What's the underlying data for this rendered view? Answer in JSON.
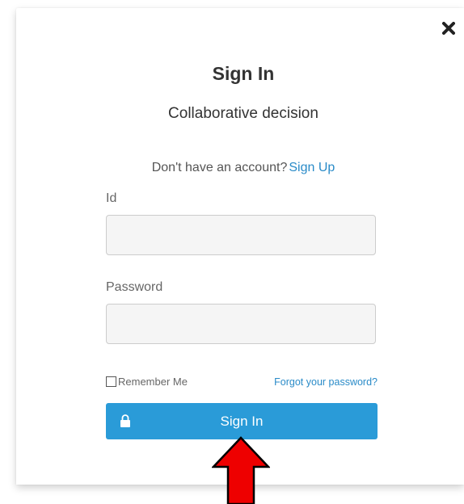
{
  "modal": {
    "title": "Sign In",
    "subtitle": "Collaborative decision",
    "account_prompt": "Don't have an account?",
    "signup_link": "Sign Up",
    "id_label": "Id",
    "id_value": "",
    "password_label": "Password",
    "password_value": "",
    "remember_label": "Remember Me",
    "remember_checked": false,
    "forgot_link": "Forgot your password?",
    "signin_button": "Sign In",
    "close_icon": "close-icon",
    "lock_icon": "lock-icon"
  },
  "annotation": {
    "arrow_icon": "up-arrow-icon",
    "arrow_color": "#ee0000"
  },
  "colors": {
    "accent": "#2a9bd8",
    "link": "#2a8bc8",
    "input_bg": "#f5f5f5"
  }
}
